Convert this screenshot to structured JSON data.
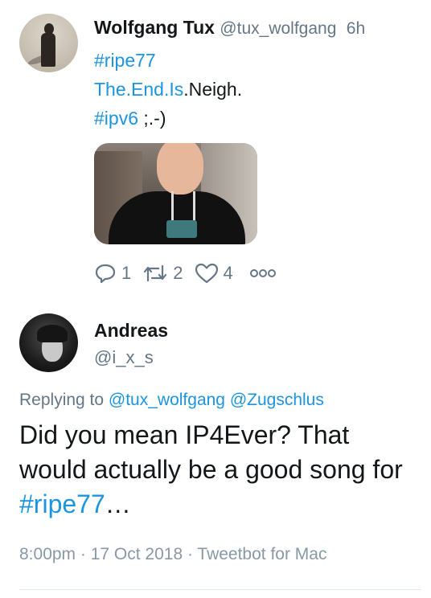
{
  "tweet1": {
    "name": "Wolfgang Tux",
    "handle": "@tux_wolfgang",
    "time": "6h",
    "lines": {
      "hashtag1": "#ripe77",
      "link_text": "The.End.Is",
      "plain_text": ".Neigh.",
      "hashtag2": "#ipv6",
      "emoticon": " ;.-)"
    },
    "actions": {
      "reply_count": "1",
      "retweet_count": "2",
      "like_count": "4"
    }
  },
  "tweet2": {
    "name": "Andreas",
    "handle": "@i_x_s",
    "replying_prefix": "Replying to ",
    "replying_user1": "@tux_wolfgang",
    "replying_user2": "@Zugschlus",
    "text_before": "Did you mean IP4Ever? That would actually be a good song for ",
    "hashtag": "#ripe77",
    "text_after": "…",
    "meta": "8:00pm · 17 Oct 2018 · Tweetbot for Mac"
  },
  "colors": {
    "link": "#1b95e0",
    "text": "#14171a",
    "muted": "#657786",
    "meta": "#8899a6"
  },
  "icons": [
    "reply-icon",
    "retweet-icon",
    "like-icon",
    "more-icon"
  ]
}
